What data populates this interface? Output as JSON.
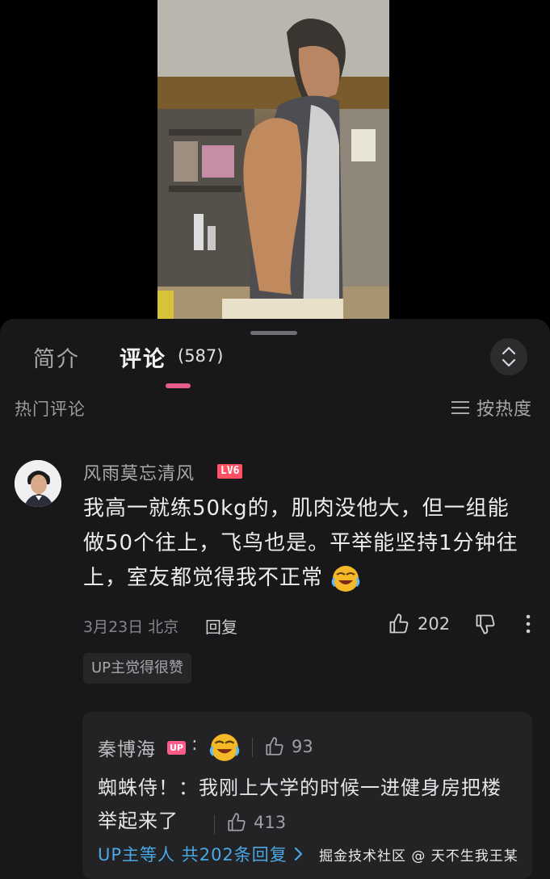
{
  "tabs": {
    "intro": "简介",
    "comments": "评论",
    "comments_count": "(587)"
  },
  "section": {
    "hot_comments": "热门评论",
    "sort": "按热度"
  },
  "comment": {
    "username": "风雨莫忘清风",
    "level": "LV6",
    "text": "我高一就练50kg的，肌肉没他大，但一组能做50个往上，飞鸟也是。平举能坚持1分钟往上，室友都觉得我不正常",
    "date_location": "3月23日 北京",
    "reply_label": "回复",
    "likes": "202",
    "up_badge": "UP主觉得很赞"
  },
  "replies": [
    {
      "username": "秦博海",
      "tag": "UP",
      "separator": ":",
      "likes": "93"
    },
    {
      "text": "蜘蛛侍！：我刚上大学的时候一进健身房把楼举起来了",
      "likes": "413"
    }
  ],
  "more_replies": "UP主等人 共202条回复",
  "watermark": "掘金技术社区 @ 天不生我王某",
  "colors": {
    "accent_pink": "#e85c89",
    "level_red": "#ff5064",
    "link_blue": "#4aa8e5",
    "sheet_bg": "#18181a"
  },
  "icons": [
    "chevron-up-down-icon",
    "sort-list-icon",
    "thumbs-up-icon",
    "thumbs-down-icon",
    "more-vertical-icon",
    "chevron-right-icon",
    "crying-laugh-emoji"
  ]
}
